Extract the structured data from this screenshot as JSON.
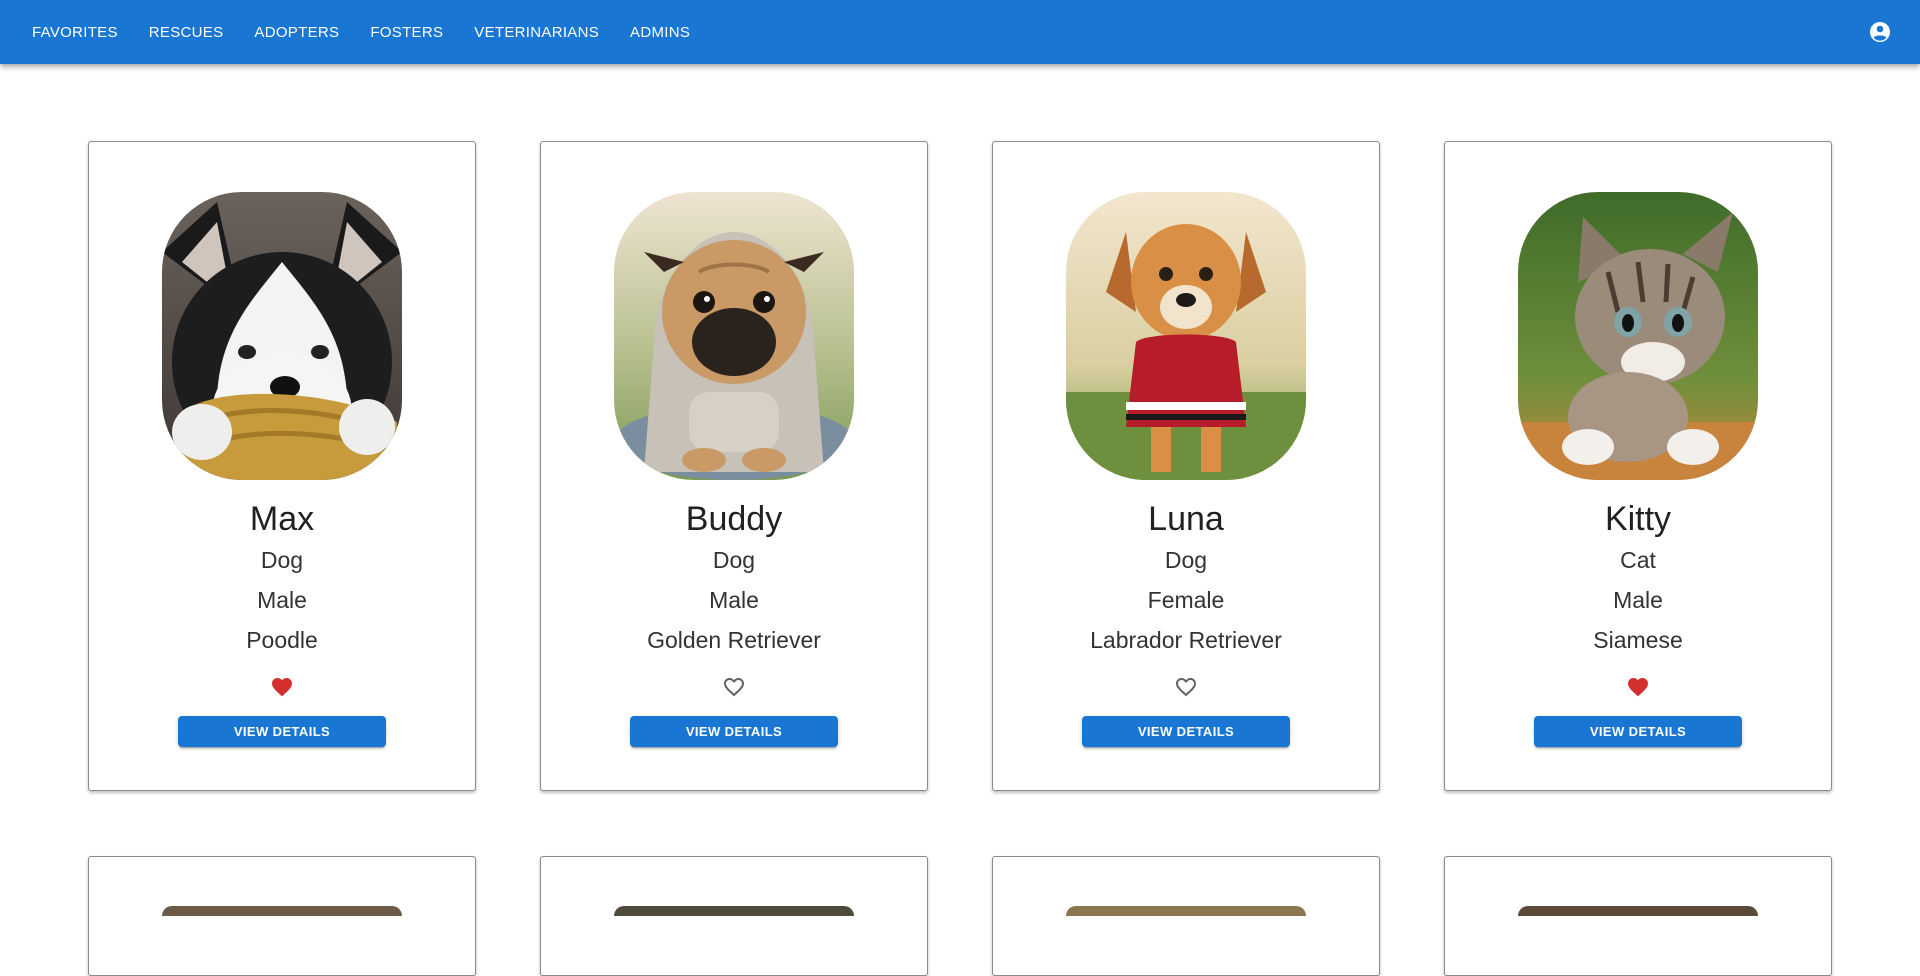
{
  "nav": {
    "items": [
      {
        "label": "FAVORITES"
      },
      {
        "label": "RESCUES"
      },
      {
        "label": "ADOPTERS"
      },
      {
        "label": "FOSTERS"
      },
      {
        "label": "VETERINARIANS"
      },
      {
        "label": "ADMINS"
      }
    ],
    "account_icon": "account-circle-icon"
  },
  "colors": {
    "primary": "#1976d2",
    "favorite": "#d32f2f",
    "not_favorite": "#616161"
  },
  "pets": [
    {
      "name": "Max",
      "species": "Dog",
      "sex": "Male",
      "breed": "Poodle",
      "favorite": true,
      "button": "VIEW DETAILS",
      "photo": "husky-puppy-photo"
    },
    {
      "name": "Buddy",
      "species": "Dog",
      "sex": "Male",
      "breed": "Golden Retriever",
      "favorite": false,
      "button": "VIEW DETAILS",
      "photo": "pug-puppy-photo"
    },
    {
      "name": "Luna",
      "species": "Dog",
      "sex": "Female",
      "breed": "Labrador Retriever",
      "favorite": false,
      "button": "VIEW DETAILS",
      "photo": "puppy-red-sweater-photo"
    },
    {
      "name": "Kitty",
      "species": "Cat",
      "sex": "Male",
      "breed": "Siamese",
      "favorite": true,
      "button": "VIEW DETAILS",
      "photo": "tabby-kitten-photo"
    }
  ]
}
